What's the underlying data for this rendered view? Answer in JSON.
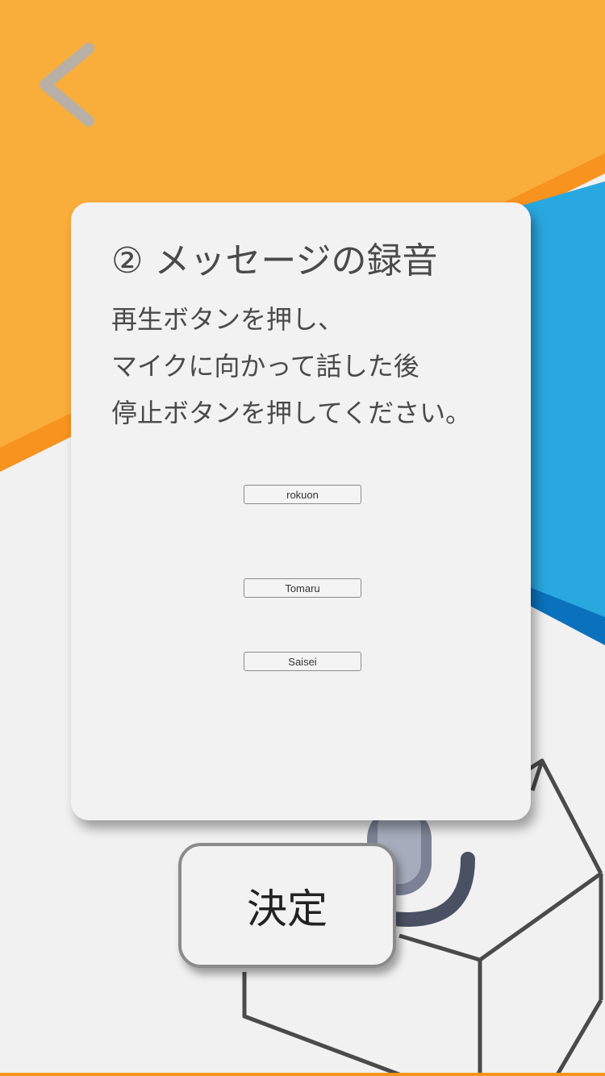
{
  "header": {
    "back_icon": "chevron-left-icon"
  },
  "card": {
    "title": "② メッセージの録音",
    "instructions": [
      "再生ボタンを押し、",
      "マイクに向かって話した後",
      "停止ボタンを押してください。"
    ]
  },
  "buttons": {
    "record_label": "rokuon",
    "stop_label": "Tomaru",
    "play_label": "Saisei"
  },
  "confirm": {
    "label": "決定"
  },
  "colors": {
    "orange": "#f9ad3b",
    "orange_dark": "#f7931e",
    "blue": "#29a8e0",
    "blue_dark": "#0a72bd",
    "card": "#f2f2f2",
    "mic": "#4a5163"
  },
  "illustration": {
    "icon": "microphone-box-icon"
  }
}
